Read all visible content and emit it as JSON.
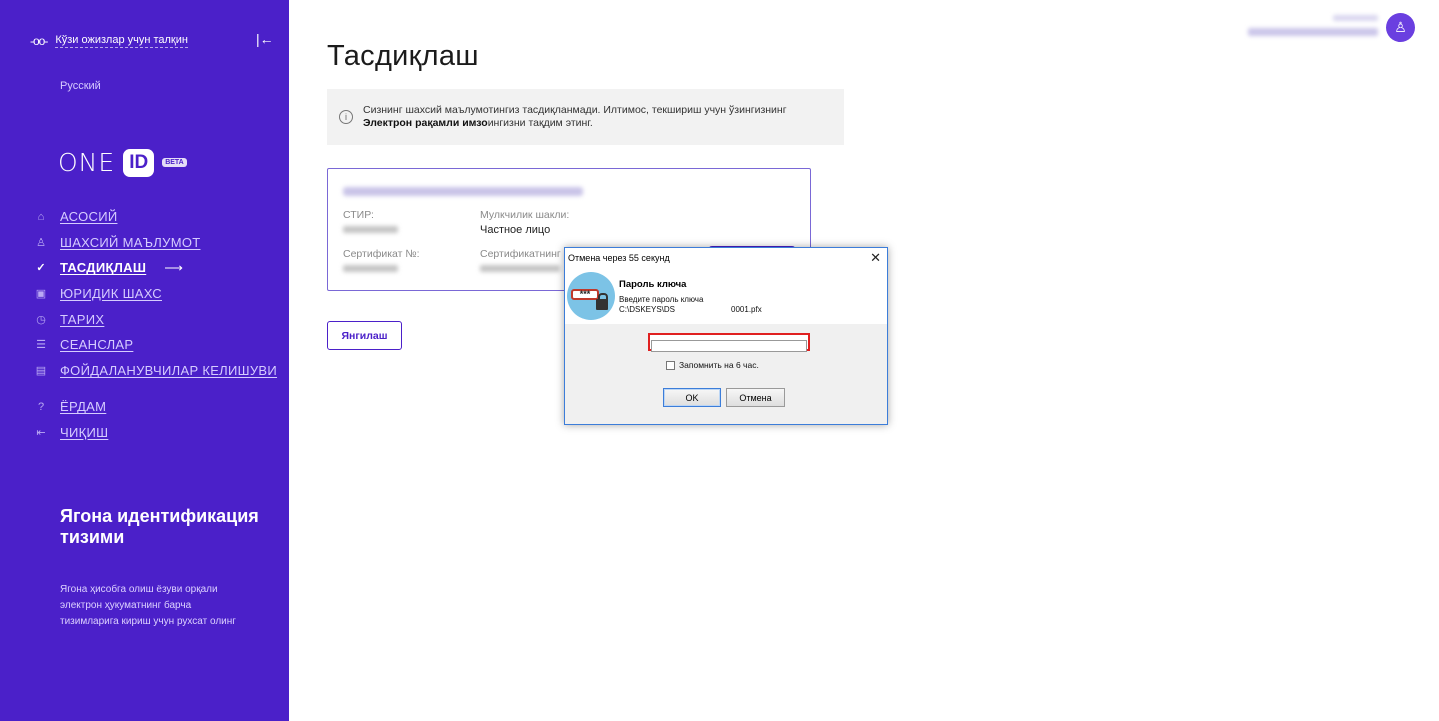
{
  "sidebar": {
    "accessibility_label": "Кўзи ожизлар учун талқин",
    "language": "Русский",
    "logo": {
      "one": "ONE",
      "id": "ID",
      "beta": "BETA"
    },
    "nav": [
      {
        "label": "АСОСИЙ",
        "icon": "home-icon"
      },
      {
        "label": "ШАХСИЙ МАЪЛУМОТ",
        "icon": "user-icon"
      },
      {
        "label": "ТАСДИҚЛАШ",
        "icon": "check-circle-icon",
        "active": true,
        "arrow": "⟶"
      },
      {
        "label": "ЮРИДИК ШАХС",
        "icon": "briefcase-icon"
      },
      {
        "label": "ТАРИХ",
        "icon": "clock-icon"
      },
      {
        "label": "СЕАНСЛАР",
        "icon": "list-icon"
      },
      {
        "label": "ФОЙДАЛАНУВЧИЛАР КЕЛИШУВИ",
        "icon": "document-icon"
      },
      {
        "label": "ЁРДАМ",
        "icon": "help-icon"
      },
      {
        "label": "ЧИҚИШ",
        "icon": "logout-icon"
      }
    ],
    "info": {
      "title": "Ягона идентификация тизими",
      "description": "Ягона ҳисобга олиш ёзуви орқали электрон ҳукуматнинг барча тизимларига кириш учун рухсат олинг"
    }
  },
  "main": {
    "title": "Тасдиқлаш",
    "notice": {
      "text_before": "Сизнинг шахсий маълумотингиз тасдиқланмади. Илтимос, текшириш учун ўзингизнинг",
      "bold": "Электрон рақамли имзо",
      "text_after": "ингизни тақдим этинг."
    },
    "certificate": {
      "stir_label": "СТИР:",
      "ownership_label": "Мулкчилик шакли:",
      "ownership_value": "Частное лицо",
      "cert_no_label": "Сертификат №:",
      "cert_period_label": "Сертификатнинг"
    },
    "refresh_button": "Янгилаш"
  },
  "dialog": {
    "title": "Отмена через 55 секунд",
    "close": "✕",
    "heading": "Пароль ключа",
    "prompt": "Введите пароль ключа",
    "path_prefix": "C:\\DSKEYS\\DS",
    "path_suffix": "0001.pfx",
    "password_value": "",
    "remember_label": "Запомнить на 6 час.",
    "ok_label": "OK",
    "cancel_label": "Отмена"
  },
  "colors": {
    "sidebar_bg": "#4b20c9",
    "accent": "#4b20c9",
    "dialog_border": "#3c7dd9",
    "password_highlight": "#e02020"
  }
}
